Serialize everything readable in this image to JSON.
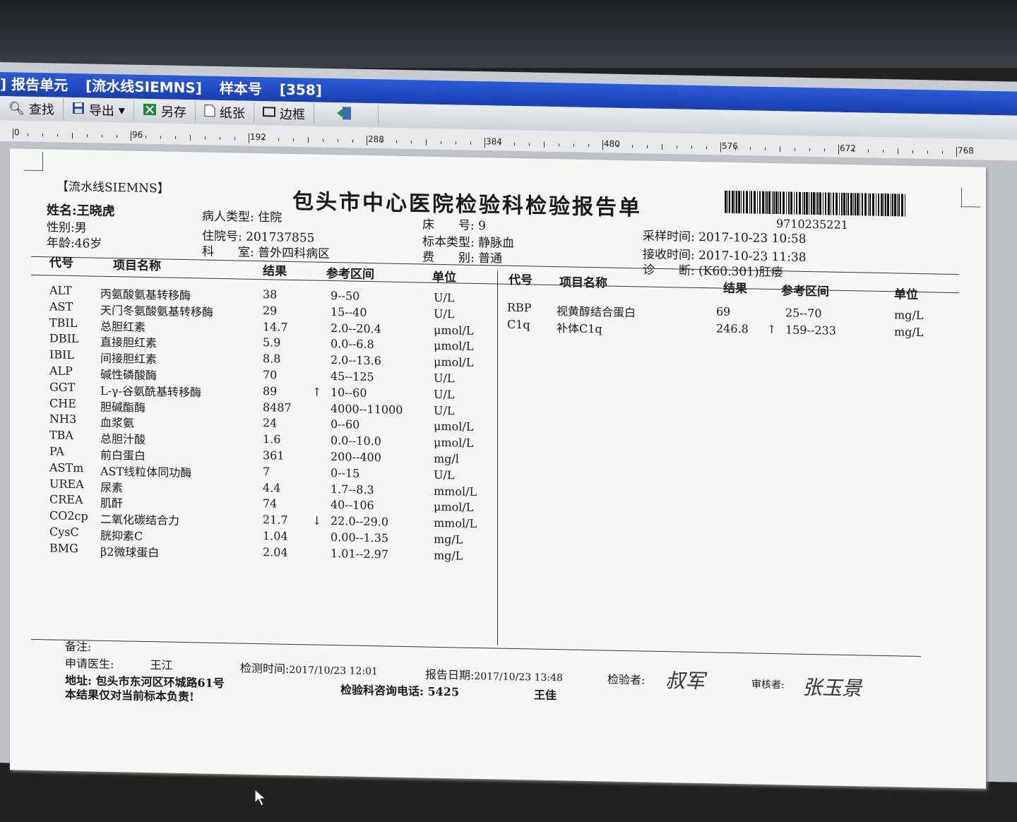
{
  "window": {
    "title_parts": [
      "] 报告单元",
      "[流水线SIEMNS]",
      "样本号",
      "[358]"
    ]
  },
  "toolbar": {
    "find": "查找",
    "export": "导出",
    "export_arrow": "▾",
    "saveas": "另存",
    "paper": "纸张",
    "border": "边框"
  },
  "ruler": {
    "marks": [
      "0",
      "96",
      "192",
      "288",
      "384",
      "480",
      "576",
      "672",
      "768"
    ]
  },
  "report": {
    "source": "【流水线SIEMNS】",
    "title": "包头市中心医院检验科检验报告单",
    "barcode_number": "9710235221",
    "patient": {
      "name_label": "姓名:",
      "name": "王晓虎",
      "sex_label": "性别:",
      "sex": "男",
      "age_label": "年龄:",
      "age": "46岁",
      "type_label": "病人类型:",
      "type": "住院",
      "admission_label": "住院号:",
      "admission": "201737855",
      "dept_label": "科　　室:",
      "dept": "普外四科病区",
      "bed_label": "床　　号:",
      "bed": "9",
      "sample_label": "标本类型:",
      "sample": "静脉血",
      "fee_label": "费　　别:",
      "fee": "普通",
      "collect_label": "采样时间:",
      "collect": "2017-10-23 10:58",
      "receive_label": "接收时间:",
      "receive": "2017-10-23 11:38",
      "diag_label": "诊　　断:",
      "diag": "(K60.301)肛瘘"
    },
    "columns": {
      "code": "代号",
      "name": "项目名称",
      "result": "结果",
      "ref": "参考区间",
      "unit": "单位"
    },
    "left_rows": [
      {
        "code": "ALT",
        "name": "丙氨酸氨基转移酶",
        "result": "38",
        "flag": "",
        "ref": "9--50",
        "unit": "U/L"
      },
      {
        "code": "AST",
        "name": "天门冬氨酸氨基转移酶",
        "result": "29",
        "flag": "",
        "ref": "15--40",
        "unit": "U/L"
      },
      {
        "code": "TBIL",
        "name": "总胆红素",
        "result": "14.7",
        "flag": "",
        "ref": "2.0--20.4",
        "unit": "μmol/L"
      },
      {
        "code": "DBIL",
        "name": "直接胆红素",
        "result": "5.9",
        "flag": "",
        "ref": "0.0--6.8",
        "unit": "μmol/L"
      },
      {
        "code": "IBIL",
        "name": "间接胆红素",
        "result": "8.8",
        "flag": "",
        "ref": "2.0--13.6",
        "unit": "μmol/L"
      },
      {
        "code": "ALP",
        "name": "碱性磷酸酶",
        "result": "70",
        "flag": "",
        "ref": "45--125",
        "unit": "U/L"
      },
      {
        "code": "GGT",
        "name": "L-γ-谷氨酰基转移酶",
        "result": "89",
        "flag": "↑",
        "ref": "10--60",
        "unit": "U/L"
      },
      {
        "code": "CHE",
        "name": "胆碱酯酶",
        "result": "8487",
        "flag": "",
        "ref": "4000--11000",
        "unit": "U/L"
      },
      {
        "code": "NH3",
        "name": "血浆氨",
        "result": "24",
        "flag": "",
        "ref": "0--60",
        "unit": "μmol/L"
      },
      {
        "code": "TBA",
        "name": "总胆汁酸",
        "result": "1.6",
        "flag": "",
        "ref": "0.0--10.0",
        "unit": "μmol/L"
      },
      {
        "code": "PA",
        "name": "前白蛋白",
        "result": "361",
        "flag": "",
        "ref": "200--400",
        "unit": "mg/l"
      },
      {
        "code": "ASTm",
        "name": "AST线粒体同功酶",
        "result": "7",
        "flag": "",
        "ref": "0--15",
        "unit": "U/L"
      },
      {
        "code": "UREA",
        "name": "尿素",
        "result": "4.4",
        "flag": "",
        "ref": "1.7--8.3",
        "unit": "mmol/L"
      },
      {
        "code": "CREA",
        "name": "肌酐",
        "result": "74",
        "flag": "",
        "ref": "40--106",
        "unit": "μmol/L"
      },
      {
        "code": "CO2cp",
        "name": "二氧化碳结合力",
        "result": "21.7",
        "flag": "↓",
        "ref": "22.0--29.0",
        "unit": "mmol/L"
      },
      {
        "code": "CysC",
        "name": "胱抑素C",
        "result": "1.04",
        "flag": "",
        "ref": "0.00--1.35",
        "unit": "mg/L"
      },
      {
        "code": "BMG",
        "name": "β2微球蛋白",
        "result": "2.04",
        "flag": "",
        "ref": "1.01--2.97",
        "unit": "mg/L"
      }
    ],
    "right_rows": [
      {
        "code": "RBP",
        "name": "视黄醇结合蛋白",
        "result": "69",
        "flag": "",
        "ref": "25--70",
        "unit": "mg/L"
      },
      {
        "code": "C1q",
        "name": "补体C1q",
        "result": "246.8",
        "flag": "↑",
        "ref": "159--233",
        "unit": "mg/L"
      }
    ],
    "footer": {
      "remark_label": "备注:",
      "doctor_label": "申请医生:",
      "doctor": "王江",
      "test_time_label": "检测时间:",
      "test_time": "2017/10/23 12:01",
      "report_date_label": "报告日期:",
      "report_date": "2017/10/23 13:48",
      "tester_label": "检验者:",
      "tester_sig": "叔军",
      "reviewer_label": "审核者:",
      "reviewer_sig": "张玉景",
      "address": "地址: 包头市东河区环城路61号",
      "phone": "检验科咨询电话: 5425",
      "phone_person": "王佳",
      "disclaimer": "本结果仅对当前标本负责!"
    }
  }
}
